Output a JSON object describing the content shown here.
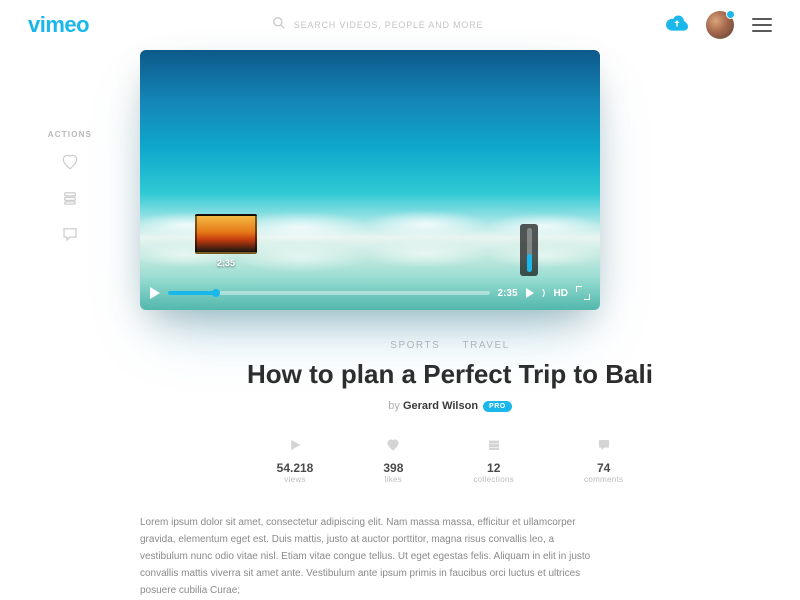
{
  "header": {
    "logo": "vimeo",
    "search_placeholder": "SEARCH VIDEOS, PEOPLE AND MORE"
  },
  "actions": {
    "label": "ACTIONS"
  },
  "video": {
    "current_time": "2:35",
    "preview_time": "2:35",
    "hd_label": "HD"
  },
  "categories": [
    "SPORTS",
    "TRAVEL"
  ],
  "title": "How to plan a Perfect Trip to Bali",
  "author": {
    "by": "by",
    "name": "Gerard Wilson",
    "badge": "PRO"
  },
  "stats": {
    "views": {
      "count": "54.218",
      "label": "views"
    },
    "likes": {
      "count": "398",
      "label": "likes"
    },
    "collections": {
      "count": "12",
      "label": "collections"
    },
    "comments": {
      "count": "74",
      "label": "comments"
    }
  },
  "description": "Lorem ipsum dolor sit amet, consectetur adipiscing elit. Nam massa massa, efficitur et ullamcorper gravida, elementum eget est. Duis mattis, justo at auctor porttitor, magna risus convallis leo, a vestibulum nunc odio vitae nisl. Etiam vitae congue tellus. Ut eget egestas felis. Aliquam in elit in justo convallis mattis viverra sit amet ante. Vestibulum ante ipsum primis in faucibus orci luctus et ultrices posuere cubilia Curae;"
}
